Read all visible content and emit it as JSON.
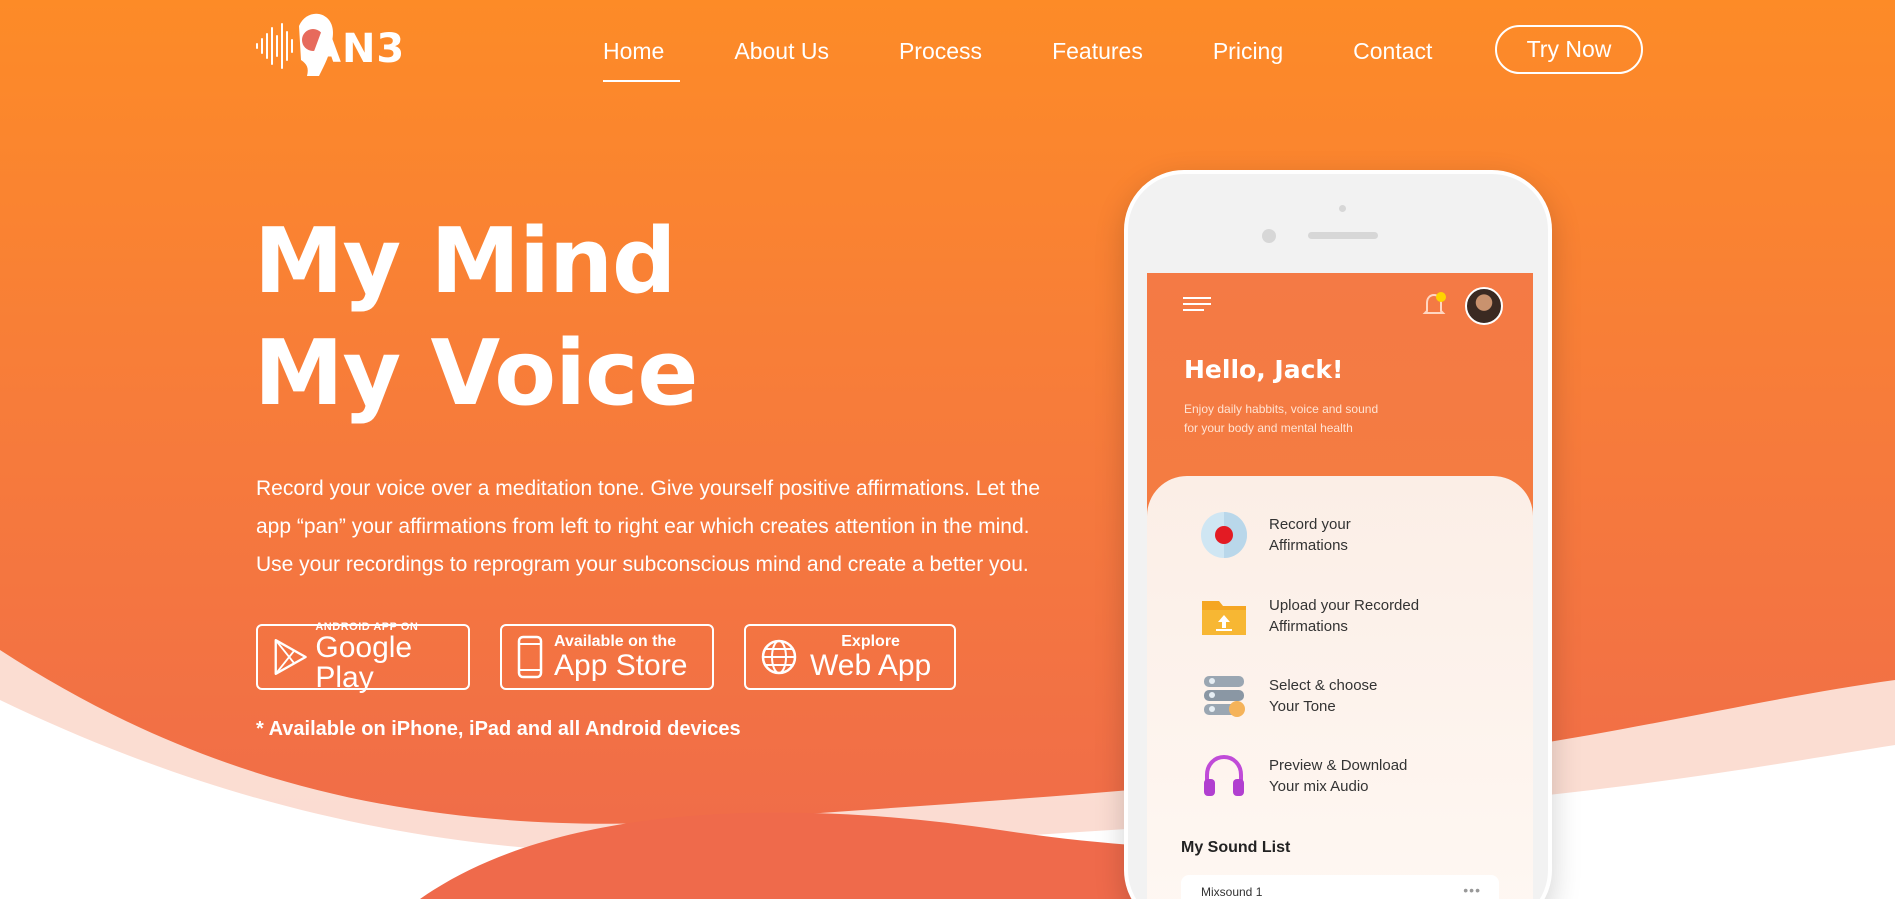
{
  "brand": {
    "logo_text": "AN3"
  },
  "nav": {
    "items": [
      "Home",
      "About Us",
      "Process",
      "Features",
      "Pricing",
      "Contact"
    ],
    "active": "Home",
    "cta_label": "Try Now"
  },
  "hero": {
    "title_line1": "My Mind",
    "title_line2": "My Voice",
    "description_line1": "Record your voice over a meditation tone. Give yourself positive affirmations. Let the",
    "description_line2": "app “pan” your affirmations from left to right ear which creates attention in the mind.",
    "description_line3": "Use your recordings to reprogram your subconscious mind and create a better you.",
    "badges": {
      "google": {
        "small": "ANDROID APP ON",
        "big": "Google Play",
        "icon": "play-icon"
      },
      "apple": {
        "small": "Available on the",
        "big": "App Store",
        "icon": "phone-icon"
      },
      "web": {
        "small": "Explore",
        "big": "Web App",
        "icon": "globe-icon"
      }
    },
    "note": "* Available on iPhone, iPad and all Android devices"
  },
  "app": {
    "greeting": "Hello, Jack!",
    "subtitle_line1": "Enjoy daily habbits, voice and sound",
    "subtitle_line2": "for your body and mental health",
    "features": [
      {
        "line1": "Record your",
        "line2": "Affirmations",
        "icon": "record-icon"
      },
      {
        "line1": "Upload your Recorded",
        "line2": "Affirmations",
        "icon": "folder-upload-icon"
      },
      {
        "line1": "Select & choose",
        "line2": "Your Tone",
        "icon": "tone-selector-icon"
      },
      {
        "line1": "Preview & Download",
        "line2": "Your mix Audio",
        "icon": "headphones-icon"
      }
    ],
    "sound_list_title": "My Sound List",
    "sound_items": [
      "Mixsound 1"
    ],
    "more_label": "•••"
  },
  "colors": {
    "orange_top": "#fd8b27",
    "orange_bottom": "#ef6a4b",
    "white": "#ffffff"
  }
}
